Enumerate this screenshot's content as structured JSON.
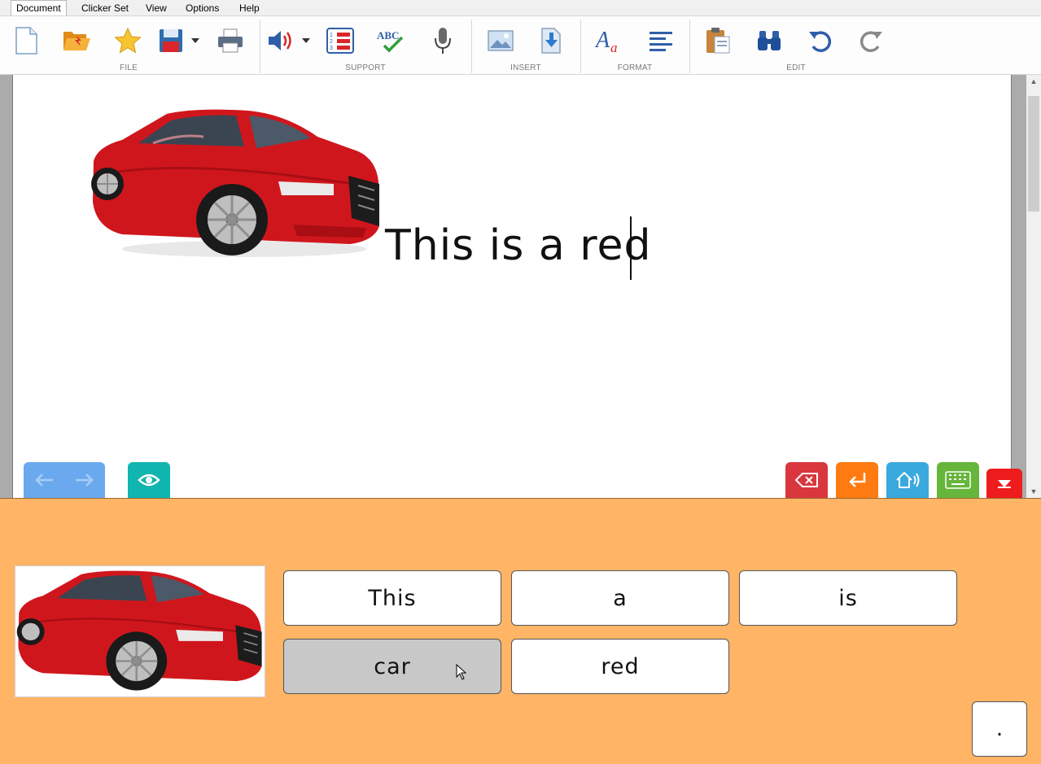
{
  "menu": {
    "items": [
      "Document",
      "Clicker Set",
      "View",
      "Options",
      "Help"
    ],
    "active": "Document"
  },
  "ribbon": {
    "groups": [
      "FILE",
      "SUPPORT",
      "INSERT",
      "FORMAT",
      "EDIT"
    ],
    "file_icons": [
      "new-document-icon",
      "open-folder-icon",
      "favourite-star-icon",
      "save-disk-icon",
      "print-icon"
    ],
    "support_icons": [
      "speaker-icon",
      "word-list-icon",
      "spellcheck-icon",
      "microphone-icon"
    ],
    "insert_icons": [
      "insert-picture-icon",
      "insert-file-icon"
    ],
    "format_icons": [
      "font-style-icon",
      "align-left-icon"
    ],
    "edit_icons": [
      "paste-clipboard-icon",
      "find-binoculars-icon",
      "undo-icon",
      "redo-icon"
    ]
  },
  "document": {
    "text": "This is a red ",
    "image": "red-car-picture"
  },
  "doc_buttons": {
    "colors": {
      "nav": "#6aa9ee",
      "view": "#10b5b0",
      "backspace": "#d9363e",
      "enter": "#ff7a10",
      "speak": "#3aa9dd",
      "keyboard": "#66b63c",
      "hide": "#ee1c1c"
    }
  },
  "grid": {
    "background": "#ffb466",
    "cells": [
      {
        "label": "This",
        "state": "normal"
      },
      {
        "label": "a",
        "state": "normal"
      },
      {
        "label": "is",
        "state": "normal"
      },
      {
        "label": "car",
        "state": "hover"
      },
      {
        "label": "red",
        "state": "normal"
      }
    ],
    "period": "."
  }
}
